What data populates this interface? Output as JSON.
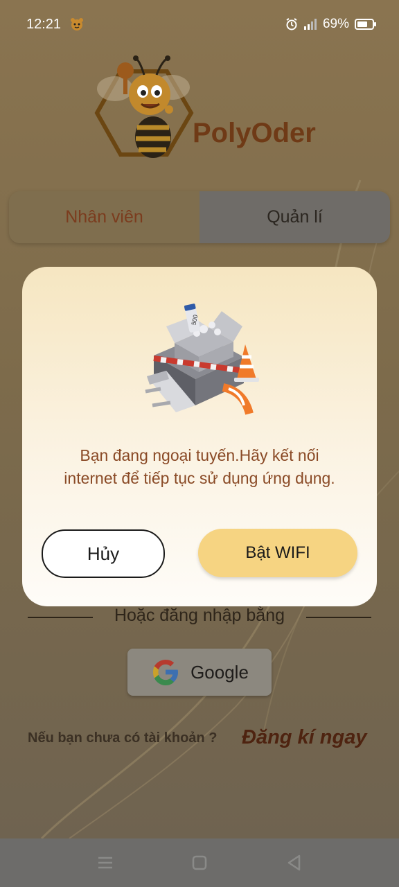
{
  "status_bar": {
    "time": "12:21",
    "battery": "69%"
  },
  "app": {
    "name": "PolyOder"
  },
  "tabs": {
    "staff": "Nhân viên",
    "manager": "Quản lí"
  },
  "login": {
    "or_login_with": "Hoặc đăng nhập bằng",
    "google": "Google",
    "no_account": "Nếu bạn chưa có tài khoản ?",
    "register": "Đăng kí ngay"
  },
  "dialog": {
    "box_label": "500",
    "message_line1": "Bạn đang ngoại tuyến.Hãy kết nối",
    "message_line2": "internet để tiếp tục sử dụng ứng dụng.",
    "cancel": "Hủy",
    "enable_wifi": "Bật WIFI"
  },
  "colors": {
    "overlay_background": "#7c6a48",
    "brand_brown": "#6f3a16",
    "wifi_button": "#f6d482",
    "dialog_text": "#8a4a26"
  },
  "icons": [
    "tiger-icon",
    "alarm-icon",
    "signal-icon",
    "battery-icon",
    "google-icon",
    "menu-icon",
    "home-icon",
    "back-icon"
  ]
}
